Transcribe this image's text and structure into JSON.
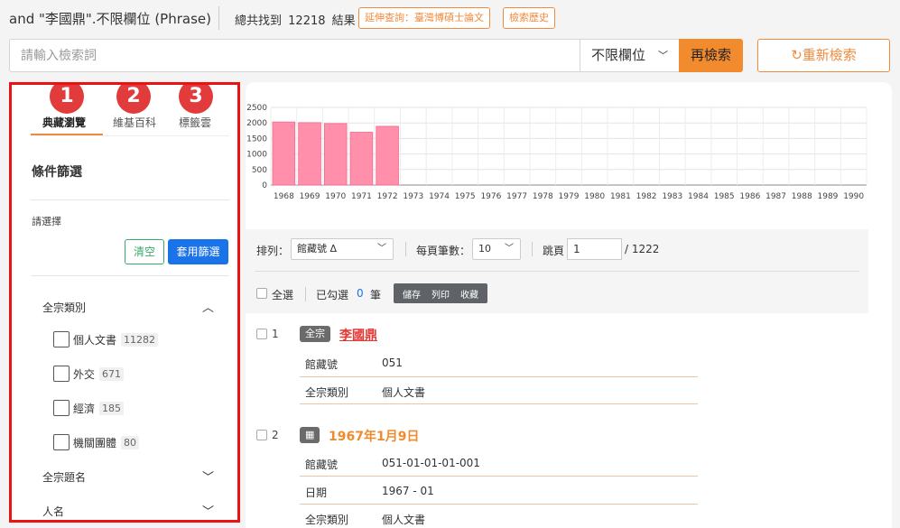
{
  "header": {
    "query": "and \"李國鼎\".不限欄位 (Phrase)",
    "total_prefix": "總共找到",
    "total_count": "12218",
    "total_suffix": "結果",
    "extend_btn": "延伸查詢：臺灣博碩士論文",
    "history_btn": "檢索歷史"
  },
  "search": {
    "placeholder": "請輸入檢索詞",
    "field": "不限欄位",
    "submit": "再檢索",
    "reset": "重新檢索"
  },
  "sidebar": {
    "tabs": [
      {
        "label": "典藏瀏覽",
        "badge": "1"
      },
      {
        "label": "維基百科",
        "badge": "2"
      },
      {
        "label": "標籤雲",
        "badge": "3"
      }
    ],
    "filter_title": "條件篩選",
    "choose_label": "請選擇",
    "clear": "清空",
    "apply": "套用篩選",
    "facets": [
      {
        "name": "全宗類別",
        "items": [
          {
            "label": "個人文書",
            "count": "11282"
          },
          {
            "label": "外交",
            "count": "671"
          },
          {
            "label": "經濟",
            "count": "185"
          },
          {
            "label": "機關團體",
            "count": "80"
          }
        ]
      },
      {
        "name": "全宗題名"
      },
      {
        "name": "人名"
      }
    ]
  },
  "controls": {
    "sort_label": "排列：",
    "sort_value": "館藏號 Δ",
    "per_page_label": "每頁筆數：",
    "per_page_value": "10",
    "jump_label": "跳頁",
    "page_value": "1",
    "page_total": "/ 1222",
    "select_all": "全選",
    "checked_label": "已勾選",
    "checked_count": "0",
    "checked_unit": "筆",
    "btn_save": "儲存",
    "btn_print": "列印",
    "btn_collect": "收藏"
  },
  "results": [
    {
      "index": "1",
      "badge": "全宗",
      "title": "李國鼎",
      "title_color": "#e53935",
      "meta": [
        {
          "label": "館藏號",
          "value": "051"
        },
        {
          "label": "全宗類別",
          "value": "個人文書"
        }
      ]
    },
    {
      "index": "2",
      "badge": "▦",
      "title": "1967年1月9日",
      "title_color": "#f08a2e",
      "meta": [
        {
          "label": "館藏號",
          "value": "051-01-01-01-001"
        },
        {
          "label": "日期",
          "value": "1967 - 01"
        },
        {
          "label": "全宗類別",
          "value": "個人文書"
        }
      ]
    }
  ],
  "chart_data": {
    "type": "bar",
    "categories": [
      "1968",
      "1969",
      "1970",
      "1971",
      "1972",
      "1973",
      "1974",
      "1975",
      "1976",
      "1977",
      "1978",
      "1979",
      "1980",
      "1981",
      "1982",
      "1983",
      "1984",
      "1985",
      "1986",
      "1987",
      "1988",
      "1989",
      "1990"
    ],
    "values": [
      2030,
      2010,
      1980,
      1700,
      1890,
      0,
      0,
      0,
      0,
      0,
      0,
      0,
      0,
      0,
      0,
      0,
      0,
      0,
      0,
      0,
      0,
      0,
      0
    ],
    "yticks": [
      "0",
      "500",
      "1000",
      "1500",
      "2000",
      "2500"
    ],
    "ylim": [
      0,
      2500
    ],
    "bar_color": "#ff8fab",
    "grid": true
  }
}
